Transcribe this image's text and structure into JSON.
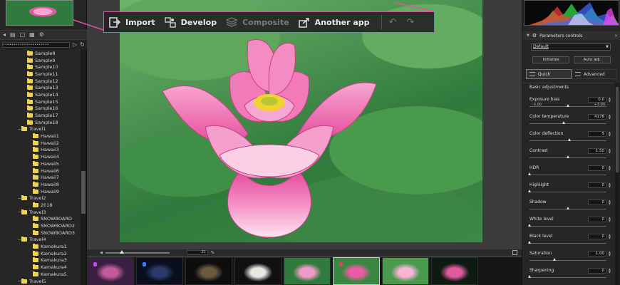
{
  "toolbar": {
    "buttons": [
      {
        "label": "Import",
        "icon": "import-icon",
        "enabled": true
      },
      {
        "label": "Develop",
        "icon": "develop-icon",
        "enabled": true
      },
      {
        "label": "Composite",
        "icon": "composite-icon",
        "enabled": false
      },
      {
        "label": "Another app",
        "icon": "export-icon",
        "enabled": true
      }
    ],
    "undo_icon": "undo-icon",
    "redo_icon": "redo-icon",
    "highlight_color": "#e0559b"
  },
  "left_panel": {
    "path_value": "••••••••••••••••••••••",
    "tree": [
      {
        "label": "Sample8",
        "level": 1,
        "expander": ""
      },
      {
        "label": "Sample9",
        "level": 1,
        "expander": ""
      },
      {
        "label": "Sample10",
        "level": 1,
        "expander": ""
      },
      {
        "label": "Sample11",
        "level": 1,
        "expander": ""
      },
      {
        "label": "Sample12",
        "level": 1,
        "expander": ""
      },
      {
        "label": "Sample13",
        "level": 1,
        "expander": ""
      },
      {
        "label": "Sample14",
        "level": 1,
        "expander": ""
      },
      {
        "label": "Sample15",
        "level": 1,
        "expander": ""
      },
      {
        "label": "Sample16",
        "level": 1,
        "expander": ""
      },
      {
        "label": "Sample17",
        "level": 1,
        "expander": ""
      },
      {
        "label": "Sample18",
        "level": 1,
        "expander": ""
      },
      {
        "label": "Travel1",
        "level": 0,
        "expander": "−"
      },
      {
        "label": "Hawaii1",
        "level": 2,
        "expander": ""
      },
      {
        "label": "Hawaii2",
        "level": 2,
        "expander": ""
      },
      {
        "label": "Hawaii3",
        "level": 2,
        "expander": ""
      },
      {
        "label": "Hawaii4",
        "level": 2,
        "expander": ""
      },
      {
        "label": "Hawaii5",
        "level": 2,
        "expander": ""
      },
      {
        "label": "Hawaii6",
        "level": 2,
        "expander": ""
      },
      {
        "label": "Hawaii7",
        "level": 2,
        "expander": ""
      },
      {
        "label": "Hawaii8",
        "level": 2,
        "expander": ""
      },
      {
        "label": "Hawaii9",
        "level": 2,
        "expander": ""
      },
      {
        "label": "Travel2",
        "level": 0,
        "expander": "−"
      },
      {
        "label": "2018",
        "level": 2,
        "expander": ""
      },
      {
        "label": "Travel3",
        "level": 0,
        "expander": "−"
      },
      {
        "label": "SNOWBOARD",
        "level": 2,
        "expander": ""
      },
      {
        "label": "SNOWBOARD2",
        "level": 2,
        "expander": ""
      },
      {
        "label": "SNOWBOARD3",
        "level": 2,
        "expander": ""
      },
      {
        "label": "Travel4",
        "level": 0,
        "expander": "−"
      },
      {
        "label": "Kamakura1",
        "level": 2,
        "expander": ""
      },
      {
        "label": "Kamakura2",
        "level": 2,
        "expander": ""
      },
      {
        "label": "Kamakura3",
        "level": 2,
        "expander": ""
      },
      {
        "label": "Kamakura4",
        "level": 2,
        "expander": ""
      },
      {
        "label": "Kamakura5",
        "level": 2,
        "expander": ""
      },
      {
        "label": "Travel5",
        "level": 0,
        "expander": "−"
      }
    ],
    "folder_color": "#f2d24a"
  },
  "viewer": {
    "zoom_value": "21",
    "zoom_unit": "%"
  },
  "filmstrip": {
    "thumbs": [
      {
        "colors": [
          "#3a2040",
          "#c35a9a"
        ],
        "badge": "#b050e0"
      },
      {
        "colors": [
          "#0a0f1e",
          "#2b3a6a"
        ],
        "badge": "#3a80ff"
      },
      {
        "colors": [
          "#0d0d10",
          "#6a5a40"
        ],
        "badge": ""
      },
      {
        "colors": [
          "#101010",
          "#e8e8e0"
        ],
        "badge": ""
      },
      {
        "colors": [
          "#2f7a3c",
          "#f09ac6"
        ],
        "badge": ""
      },
      {
        "colors": [
          "#3a8743",
          "#e95ca4"
        ],
        "badge": "#e04060"
      },
      {
        "colors": [
          "#4a9a4e",
          "#f6b4d6"
        ],
        "badge": ""
      },
      {
        "colors": [
          "#0f1a10",
          "#e05a9e"
        ],
        "badge": ""
      }
    ],
    "selected_index": 5
  },
  "right_panel": {
    "header": "Parameters controls",
    "preset": "Default",
    "initialize_label": "Initialize",
    "auto_adj_label": "Auto adj.",
    "quick_label": "Quick",
    "advanced_label": "Advanced",
    "section_label": "Basic adjustments",
    "params": [
      {
        "label": "Exposure bias",
        "value": "0.0",
        "range_min": "-3.00",
        "range_max": "+3.00",
        "level": 0.5
      },
      {
        "label": "Color temperature",
        "value": "4178",
        "range_min": "",
        "range_max": "",
        "level": 0.45
      },
      {
        "label": "Color deflection",
        "value": "5",
        "range_min": "",
        "range_max": "",
        "level": 0.52
      },
      {
        "label": "Contrast",
        "value": "1.50",
        "range_min": "",
        "range_max": "",
        "level": 0.5
      },
      {
        "label": "HDR",
        "value": "0",
        "range_min": "",
        "range_max": "",
        "level": 0.0
      },
      {
        "label": "Highlight",
        "value": "0",
        "range_min": "",
        "range_max": "",
        "level": 0.0
      },
      {
        "label": "Shadow",
        "value": "0",
        "range_min": "",
        "range_max": "",
        "level": 0.5
      },
      {
        "label": "White level",
        "value": "0",
        "range_min": "",
        "range_max": "",
        "level": 0.0
      },
      {
        "label": "Black level",
        "value": "0",
        "range_min": "",
        "range_max": "",
        "level": 0.0
      },
      {
        "label": "Saturation",
        "value": "1.00",
        "range_min": "",
        "range_max": "",
        "level": 0.33
      },
      {
        "label": "Sharpening",
        "value": "0",
        "range_min": "",
        "range_max": "",
        "level": 0.0
      }
    ]
  }
}
